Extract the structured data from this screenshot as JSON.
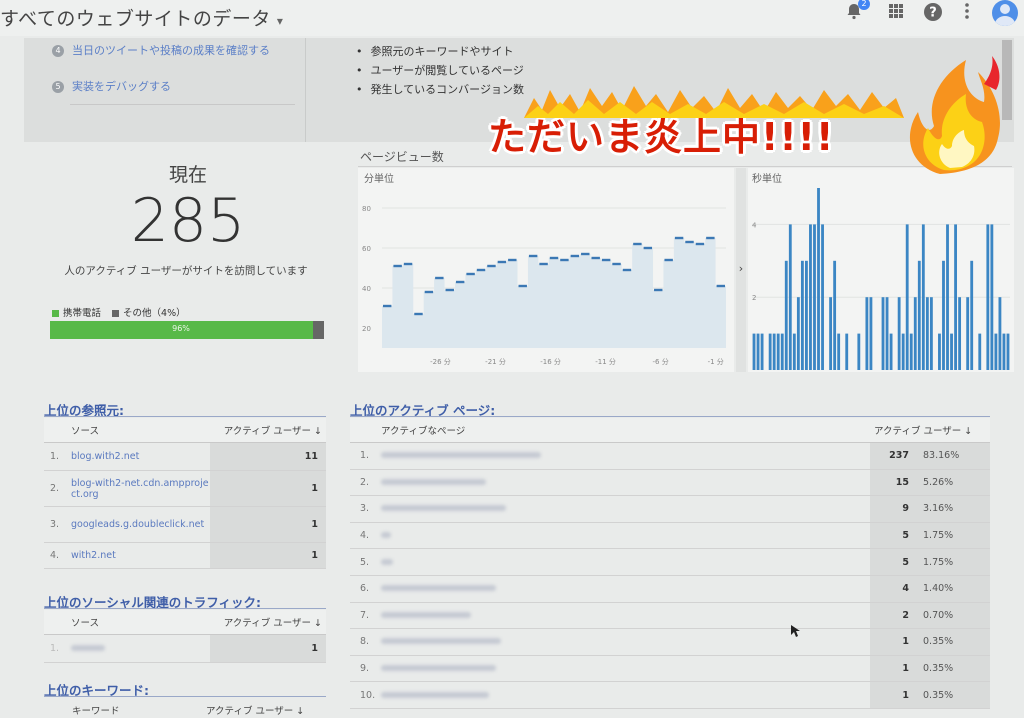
{
  "header": {
    "property_title": "すべてのウェブサイトのデータ",
    "notification_count": "2"
  },
  "info_panel": {
    "steps": [
      {
        "num": "4",
        "label": "当日のツイートや投稿の成果を確認する"
      },
      {
        "num": "5",
        "label": "実装をデバッグする"
      }
    ],
    "bullets": [
      "参照元のキーワードやサイト",
      "ユーザーが閲覧しているページ",
      "発生しているコンバージョン数"
    ]
  },
  "overlay": {
    "text": "ただいま炎上中!!!!"
  },
  "realtime": {
    "now_label": "現在",
    "count": "285",
    "description": "人のアクティブ ユーザーがサイトを訪問しています",
    "legend_mobile": "携帯電話",
    "legend_other": "その他（4%）",
    "mobile_percent_label": "96%",
    "mobile_fraction": 0.96,
    "colors": {
      "mobile": "#58b948",
      "other": "#666666"
    }
  },
  "pageviews": {
    "title": "ページビュー数",
    "per_minute": {
      "label": "分単位",
      "y_ticks": [
        "80",
        "60",
        "40",
        "20"
      ],
      "x_ticks": [
        "-26 分",
        "-21 分",
        "-16 分",
        "-11 分",
        "-6 分",
        "-1 分"
      ]
    },
    "per_second": {
      "label": "秒単位",
      "y_ticks": [
        "4",
        "2"
      ]
    },
    "expand_icon": "chevron-right-icon"
  },
  "chart_data": [
    {
      "type": "area",
      "title": "分単位",
      "y_ticks": [
        "80",
        "60",
        "40",
        "20"
      ],
      "x_ticks": [
        "-26 分",
        "-21 分",
        "-16 分",
        "-11 分",
        "-6 分",
        "-1 分"
      ],
      "ylim": [
        10,
        90
      ],
      "values": [
        31,
        51,
        52,
        27,
        38,
        45,
        39,
        43,
        47,
        49,
        51,
        53,
        54,
        41,
        56,
        52,
        55,
        54,
        56,
        57,
        55,
        54,
        52,
        49,
        62,
        60,
        39,
        54,
        65,
        63,
        62,
        65,
        41
      ]
    },
    {
      "type": "bar",
      "title": "秒単位",
      "y_ticks": [
        "4",
        "2"
      ],
      "ylim": [
        0,
        5
      ],
      "values": [
        1,
        1,
        1,
        0,
        1,
        1,
        1,
        1,
        3,
        4,
        1,
        2,
        3,
        3,
        4,
        4,
        5,
        4,
        0,
        2,
        3,
        1,
        0,
        1,
        0,
        0,
        1,
        0,
        2,
        2,
        0,
        0,
        2,
        2,
        1,
        0,
        2,
        1,
        4,
        1,
        2,
        3,
        4,
        2,
        2,
        0,
        1,
        3,
        4,
        1,
        4,
        2,
        0,
        2,
        3,
        0,
        1,
        0,
        4,
        4,
        1,
        2,
        1,
        1
      ]
    }
  ],
  "referrals": {
    "title": "上位の参照元:",
    "col_source": "ソース",
    "col_users": "アクティブ ユーザー ↓",
    "rows": [
      {
        "num": "1.",
        "source": "blog.with2.net",
        "users": "11"
      },
      {
        "num": "2.",
        "source": "blog-with2-net.cdn.ampproject.org",
        "users": "1"
      },
      {
        "num": "3.",
        "source": "googleads.g.doubleclick.net",
        "users": "1"
      },
      {
        "num": "4.",
        "source": "with2.net",
        "users": "1"
      }
    ]
  },
  "social": {
    "title": "上位のソーシャル関連のトラフィック:",
    "col_source": "ソース",
    "col_users": "アクティブ ユーザー ↓",
    "rows": [
      {
        "num": "1.",
        "users": "1"
      }
    ]
  },
  "keywords": {
    "title": "上位のキーワード:",
    "col_keyword": "キーワード",
    "col_users": "アクティブ ユーザー ↓"
  },
  "active_pages": {
    "title": "上位のアクティブ ページ:",
    "col_page": "アクティブなページ",
    "col_users": "アクティブ ユーザー ↓",
    "rows": [
      {
        "num": "1.",
        "users": "237",
        "pct": "83.16%"
      },
      {
        "num": "2.",
        "users": "15",
        "pct": "5.26%"
      },
      {
        "num": "3.",
        "users": "9",
        "pct": "3.16%"
      },
      {
        "num": "4.",
        "users": "5",
        "pct": "1.75%"
      },
      {
        "num": "5.",
        "users": "5",
        "pct": "1.75%"
      },
      {
        "num": "6.",
        "users": "4",
        "pct": "1.40%"
      },
      {
        "num": "7.",
        "users": "2",
        "pct": "0.70%"
      },
      {
        "num": "8.",
        "users": "1",
        "pct": "0.35%"
      },
      {
        "num": "9.",
        "users": "1",
        "pct": "0.35%"
      },
      {
        "num": "10.",
        "users": "1",
        "pct": "0.35%"
      }
    ]
  }
}
